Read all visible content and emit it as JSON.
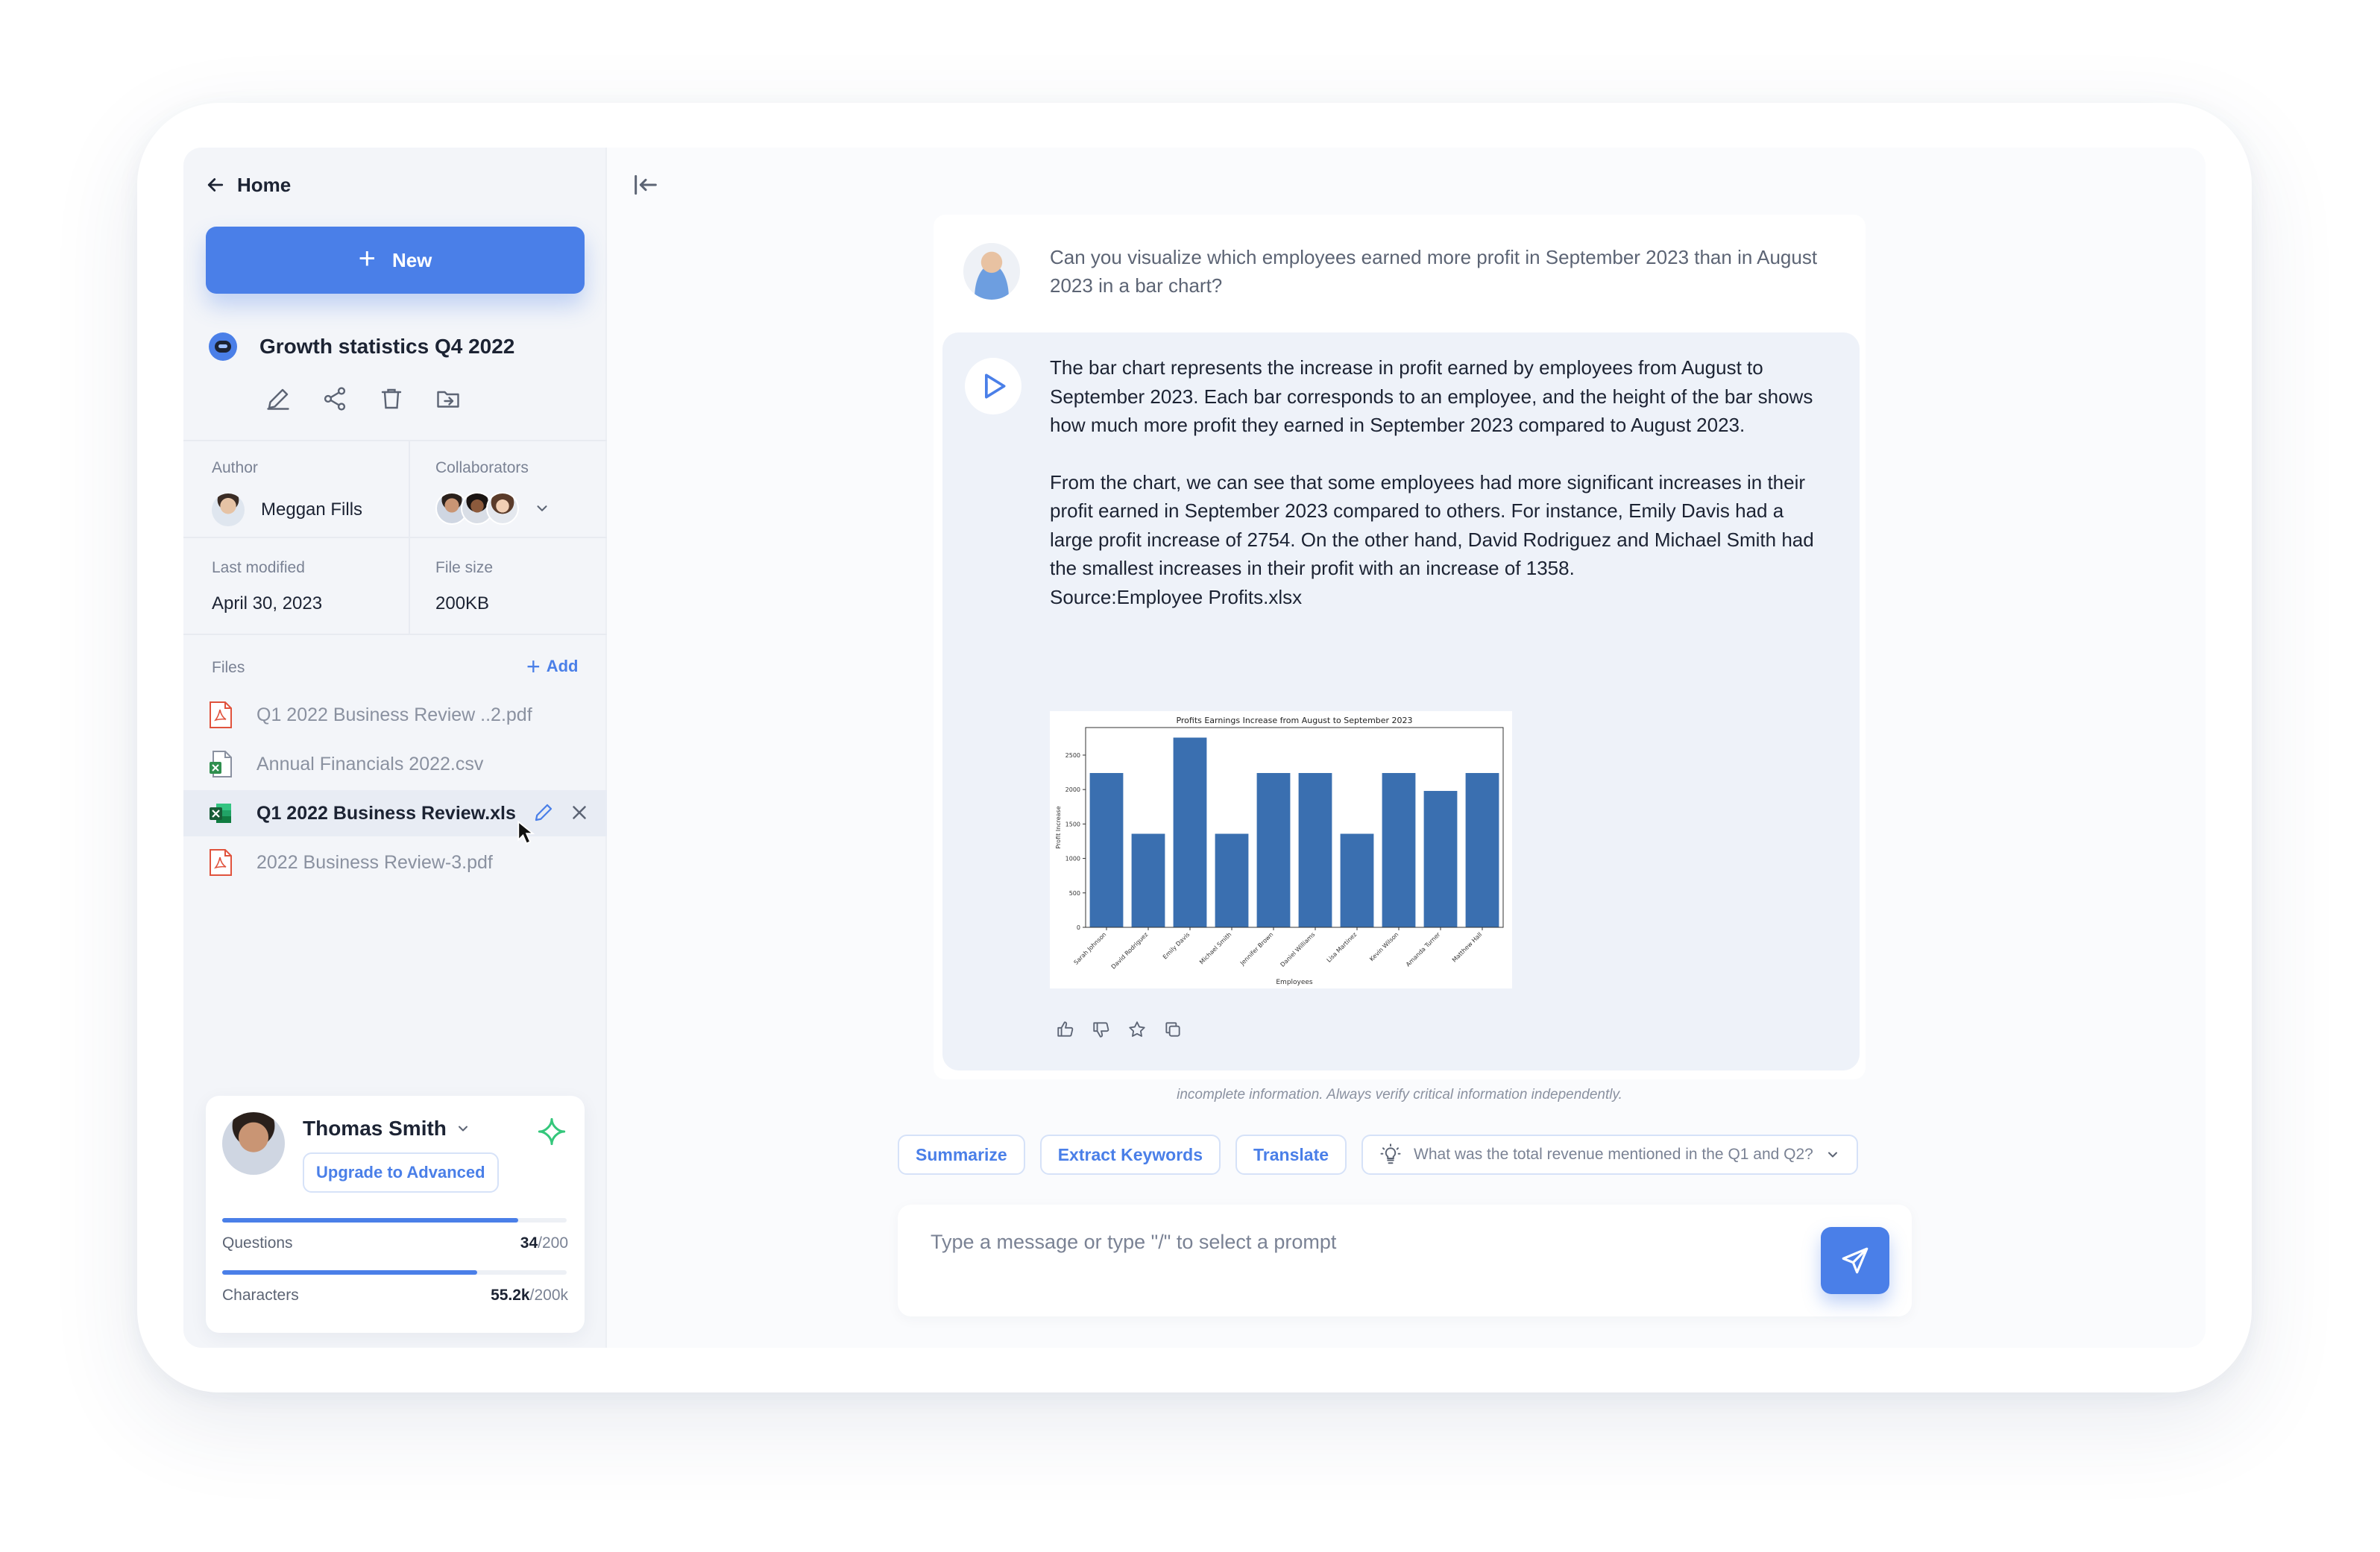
{
  "sidebar": {
    "home_label": "Home",
    "new_label": "New",
    "doc_title": "Growth statistics Q4 2022",
    "meta": {
      "author_label": "Author",
      "author_name": "Meggan Fills",
      "collaborators_label": "Collaborators",
      "last_modified_label": "Last modified",
      "last_modified_value": "April 30, 2023",
      "file_size_label": "File size",
      "file_size_value": "200KB"
    },
    "files_label": "Files",
    "add_label": "Add",
    "files": [
      {
        "name": "Q1 2022 Business Review ..2.pdf",
        "type": "pdf"
      },
      {
        "name": "Annual Financials 2022.csv",
        "type": "csv"
      },
      {
        "name": "Q1 2022 Business Review.xls",
        "type": "xls",
        "active": true
      },
      {
        "name": "2022 Business Review-3.pdf",
        "type": "pdf"
      }
    ],
    "user": {
      "name": "Thomas Smith",
      "upgrade_label": "Upgrade to Advanced",
      "questions_label": "Questions",
      "questions_used": "34",
      "questions_total": "/200",
      "questions_fraction": 0.86,
      "characters_label": "Characters",
      "characters_used": "55.2k",
      "characters_total": "/200k",
      "characters_fraction": 0.74
    }
  },
  "chat": {
    "question": "Can you visualize which employees earned more profit in September 2023 than in August 2023 in a bar chart?",
    "answer_p1": "The bar chart represents the increase in profit earned by employees from August to September 2023. Each bar corresponds to an employee, and the height of the bar shows how much more profit they earned in September 2023 compared to August 2023.",
    "answer_p2": " From the chart, we can see that some employees had more significant increases in their profit earned in September 2023 compared to others. For instance, Emily Davis had a large profit increase of 2754. On the other hand, David Rodriguez and Michael Smith had the smallest increases in their profit with an increase of 1358.",
    "answer_source": " Source:Employee Profits.xlsx",
    "disclaimer": "incomplete information. Always verify critical information independently.",
    "chips": {
      "summarize": "Summarize",
      "extract": "Extract Keywords",
      "translate": "Translate",
      "suggestion": "What was the total revenue mentioned in the Q1 and Q2?"
    },
    "composer_placeholder": "Type a message or type \"/\" to select a prompt"
  },
  "colors": {
    "accent": "#4a7fe8",
    "bar": "#3a6fb0"
  },
  "chart_data": {
    "type": "bar",
    "title": "Profits Earnings Increase from August to September 2023",
    "xlabel": "Employees",
    "ylabel": "Profit Increase",
    "categories": [
      "Sarah Johnson",
      "David Rodriguez",
      "Emily Davis",
      "Michael Smith",
      "Jennifer Brown",
      "Daniel Williams",
      "Lisa Martinez",
      "Kevin Wilson",
      "Amanda Turner",
      "Matthew Hall"
    ],
    "values": [
      2240,
      1358,
      2754,
      1358,
      2240,
      2240,
      1358,
      2240,
      1980,
      2240
    ],
    "ylim": [
      0,
      2900
    ],
    "yticks": [
      0,
      500,
      1000,
      1500,
      2000,
      2500
    ],
    "grid": false,
    "legend": "none"
  }
}
